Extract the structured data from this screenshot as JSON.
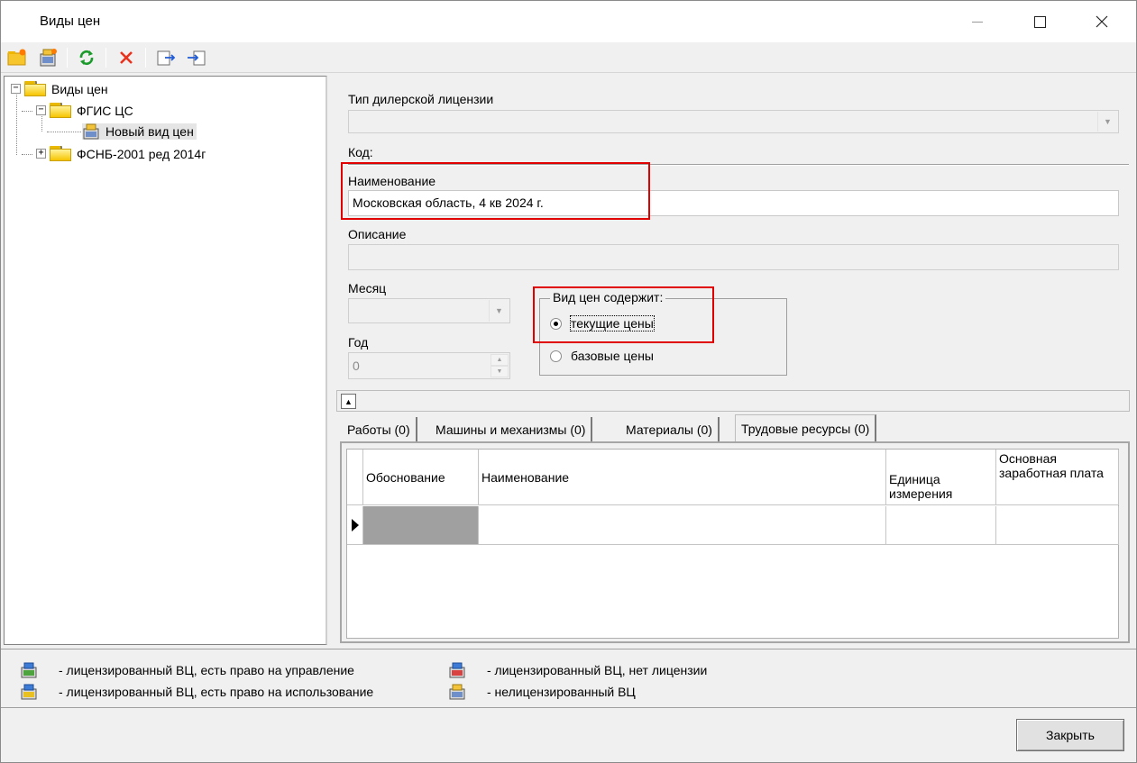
{
  "window": {
    "title": "Виды цен",
    "minimize_icon": "minimize-icon",
    "maximize_icon": "maximize-icon",
    "close_icon": "close-icon"
  },
  "toolbar": {
    "buttons": [
      {
        "icon": "new-folder-icon"
      },
      {
        "icon": "new-item-icon"
      },
      {
        "icon": "refresh-icon"
      },
      {
        "icon": "delete-icon"
      },
      {
        "icon": "export-icon"
      },
      {
        "icon": "import-icon"
      }
    ]
  },
  "tree": {
    "root": {
      "label": "Виды цен",
      "expander": "⊟"
    },
    "items": [
      {
        "label": "ФГИС ЦС",
        "expander": "⊟"
      },
      {
        "label": "Новый вид цен"
      },
      {
        "label": "ФСНБ-2001 ред 2014г",
        "expander": "⊞"
      }
    ]
  },
  "form": {
    "dealer_license_label": "Тип дилерской лицензии",
    "dealer_license_value": "",
    "code_label": "Код:",
    "name_label": "Наименование",
    "name_value": "Московская область, 4 кв 2024 г.",
    "description_label": "Описание",
    "description_value": "",
    "month_label": "Месяц",
    "month_value": "",
    "year_label": "Год",
    "year_value": "0",
    "price_group": {
      "title": "Вид цен содержит:",
      "options": [
        {
          "label": "текущие цены",
          "selected": true
        },
        {
          "label": "базовые цены",
          "selected": false
        }
      ]
    }
  },
  "tabs": [
    {
      "label": "Работы (0)",
      "active": false
    },
    {
      "label": "Машины и механизмы (0)",
      "active": false
    },
    {
      "label": "Материалы (0)",
      "active": false
    },
    {
      "label": "Трудовые ресурсы (0)",
      "active": true
    }
  ],
  "grid": {
    "columns": [
      "Обоснование",
      "Наименование",
      "Единица измерения",
      "Основная заработная плата"
    ],
    "rows": [
      [
        "",
        "",
        "",
        ""
      ]
    ]
  },
  "legend": [
    {
      "icon": "licensed-manage-icon",
      "text": "- лицензированный ВЦ, есть право на управление"
    },
    {
      "icon": "licensed-use-icon",
      "text": "- лицензированный ВЦ, есть право на использование"
    },
    {
      "icon": "licensed-no-license-icon",
      "text": "- лицензированный ВЦ, нет лицензии"
    },
    {
      "icon": "unlicensed-icon",
      "text": "- нелицензированный ВЦ"
    }
  ],
  "footer": {
    "close_label": "Закрыть"
  },
  "colors": {
    "highlight_red": "#e00000",
    "grid_selected_cell": "#a0a0a0"
  }
}
